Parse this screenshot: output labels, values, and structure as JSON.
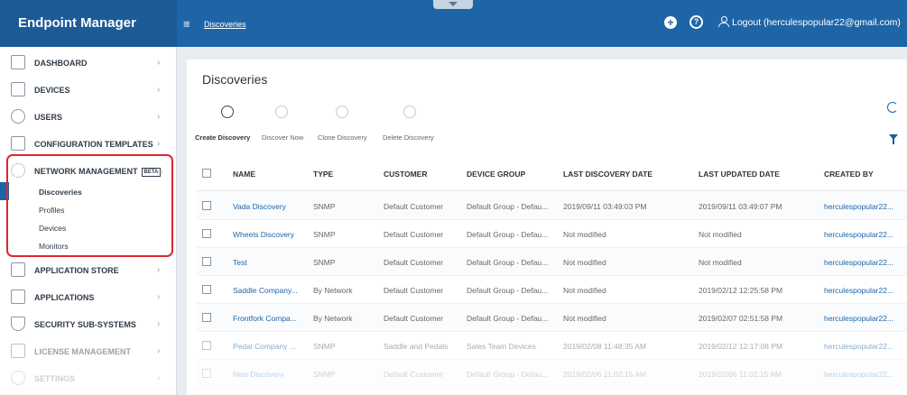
{
  "app": {
    "title": "Endpoint Manager"
  },
  "header": {
    "breadcrumb": "Discoveries",
    "logout_label": "Logout (herculespopular22@gmail.com)"
  },
  "sidebar": {
    "items": [
      {
        "label": "DASHBOARD",
        "icon": "dashboard-icon"
      },
      {
        "label": "DEVICES",
        "icon": "devices-icon"
      },
      {
        "label": "USERS",
        "icon": "users-icon"
      },
      {
        "label": "CONFIGURATION TEMPLATES",
        "icon": "templates-icon"
      },
      {
        "label": "NETWORK MANAGEMENT",
        "badge": "BETA",
        "icon": "network-icon"
      },
      {
        "label": "APPLICATION STORE",
        "icon": "store-icon"
      },
      {
        "label": "APPLICATIONS",
        "icon": "applications-icon"
      },
      {
        "label": "SECURITY SUB-SYSTEMS",
        "icon": "shield-icon"
      },
      {
        "label": "LICENSE MANAGEMENT",
        "icon": "license-icon"
      },
      {
        "label": "SETTINGS",
        "icon": "gear-icon"
      }
    ],
    "subitems": [
      "Discoveries",
      "Profiles",
      "Devices",
      "Monitors"
    ]
  },
  "main": {
    "title": "Discoveries",
    "toolbar": [
      {
        "label": "Create Discovery",
        "active": true
      },
      {
        "label": "Discover Now",
        "active": false
      },
      {
        "label": "Clone Discovery",
        "active": false
      },
      {
        "label": "Delete Discovery",
        "active": false
      }
    ],
    "columns": [
      "NAME",
      "TYPE",
      "CUSTOMER",
      "DEVICE GROUP",
      "LAST DISCOVERY DATE",
      "LAST UPDATED DATE",
      "CREATED BY"
    ],
    "rows": [
      [
        "Vada Discovery",
        "SNMP",
        "Default Customer",
        "Default Group - Defau...",
        "2019/09/11 03:49:03 PM",
        "2019/09/11 03:49:07 PM",
        "herculespopular22..."
      ],
      [
        "Wheels Discovery",
        "SNMP",
        "Default Customer",
        "Default Group - Defau...",
        "Not modified",
        "Not modified",
        "herculespopular22..."
      ],
      [
        "Test",
        "SNMP",
        "Default Customer",
        "Default Group - Defau...",
        "Not modified",
        "Not modified",
        "herculespopular22..."
      ],
      [
        "Saddle Company...",
        "By Network",
        "Default Customer",
        "Default Group - Defau...",
        "Not modified",
        "2019/02/12 12:25:58 PM",
        "herculespopular22..."
      ],
      [
        "Frontfork Compa...",
        "By Network",
        "Default Customer",
        "Default Group - Defau...",
        "Not modified",
        "2019/02/07 02:51:58 PM",
        "herculespopular22..."
      ],
      [
        "Pedal Company ...",
        "SNMP",
        "Saddle and Pedals",
        "Sales Team Devices",
        "2019/02/08 11:48:35 AM",
        "2019/02/12 12:17:08 PM",
        "herculespopular22..."
      ],
      [
        "New Discovery",
        "SNMP",
        "Default Customer",
        "Default Group - Defau...",
        "2019/02/06 11:02:15 AM",
        "2019/02/06 11:02:15 AM",
        "herculespopular22..."
      ]
    ]
  },
  "colors": {
    "topbar": "#1e65a8",
    "brand": "#1d5b97",
    "highlight": "#e0262d",
    "link": "#1e65a8"
  }
}
